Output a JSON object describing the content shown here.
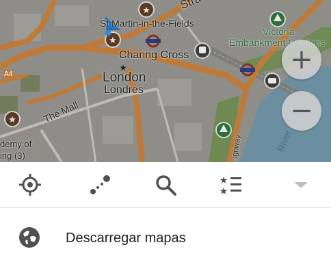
{
  "map": {
    "labels": {
      "strand": "Stra",
      "st_martin": "St Martin-in-the-Fields",
      "victoria": "Victoria",
      "embankment_gardens": "Embankment Gardens",
      "charing_cross": "Charing Cross",
      "london": "London",
      "londres": "Londres",
      "the_mall": "The Mall",
      "a4": "A4",
      "academy": "demy of",
      "building": "ing (3)",
      "highway": "ighway",
      "river": "River"
    }
  },
  "zoom": {
    "in_symbol": "+",
    "out_symbol": "−"
  },
  "toolbar": {
    "icons": [
      "my-location-icon",
      "route-icon",
      "search-icon",
      "bookmarks-icon",
      "dropdown-icon"
    ]
  },
  "menu": {
    "download_maps_label": "Descarregar mapas"
  }
}
